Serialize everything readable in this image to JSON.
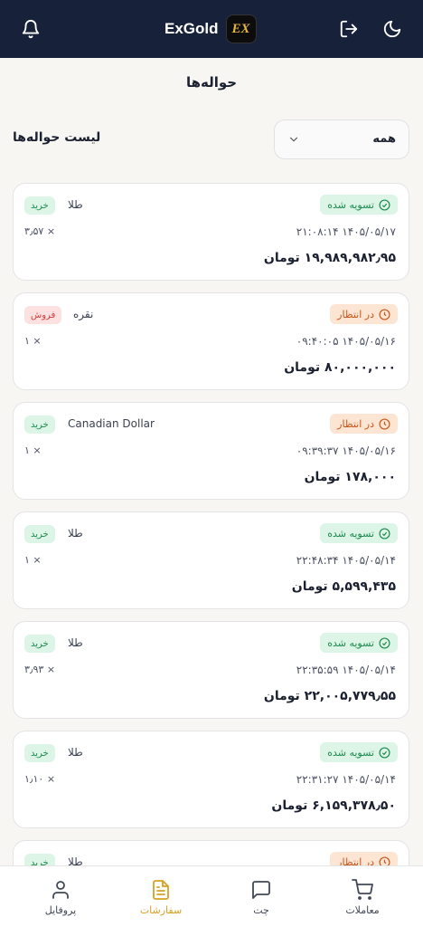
{
  "header": {
    "brand": "ExGold",
    "logo_text": "EX"
  },
  "page": {
    "title": "حواله‌ها",
    "list_title": "لیست حواله‌ها",
    "filter_value": "همه"
  },
  "transfers": [
    {
      "status": "تسویه شده",
      "side": "خرید",
      "asset": "طلا",
      "datetime": "۲۱:۰۸:۱۴ ۱۴۰۵/۰۵/۱۷",
      "qty": "۳٫۵۷ ×",
      "amount": "۱۹,۹۸۹,۹۸۲٫۹۵ تومان"
    },
    {
      "status": "در انتظار",
      "side": "فروش",
      "asset": "نقره",
      "datetime": "۰۹:۴۰:۰۵ ۱۴۰۵/۰۵/۱۶",
      "qty": "۱ ×",
      "amount": "۸۰,۰۰۰,۰۰۰ تومان"
    },
    {
      "status": "در انتظار",
      "side": "خرید",
      "asset": "Canadian Dollar",
      "datetime": "۰۹:۳۹:۳۷ ۱۴۰۵/۰۵/۱۶",
      "qty": "۱ ×",
      "amount": "۱۷۸,۰۰۰ تومان"
    },
    {
      "status": "تسویه شده",
      "side": "خرید",
      "asset": "طلا",
      "datetime": "۲۲:۴۸:۳۴ ۱۴۰۵/۰۵/۱۴",
      "qty": "۱ ×",
      "amount": "۵,۵۹۹,۴۳۵ تومان"
    },
    {
      "status": "تسویه شده",
      "side": "خرید",
      "asset": "طلا",
      "datetime": "۲۲:۳۵:۵۹ ۱۴۰۵/۰۵/۱۴",
      "qty": "۳٫۹۳ ×",
      "amount": "۲۲,۰۰۵,۷۷۹٫۵۵ تومان"
    },
    {
      "status": "تسویه شده",
      "side": "خرید",
      "asset": "طلا",
      "datetime": "۲۲:۳۱:۲۷ ۱۴۰۵/۰۵/۱۴",
      "qty": "۱٫۱۰ ×",
      "amount": "۶,۱۵۹,۳۷۸٫۵۰ تومان"
    },
    {
      "status": "در انتظار",
      "side": "خرید",
      "asset": "طلا",
      "datetime": "",
      "qty": "",
      "amount": ""
    }
  ],
  "nav": {
    "trades": "معاملات",
    "chat": "چت",
    "orders": "سفارشات",
    "profile": "پروفایل"
  },
  "colors": {
    "header_bg": "#17223a",
    "accent": "#d8a021",
    "settled": "#1e8a4f",
    "pending": "#c9561b",
    "sell": "#d23b3b"
  }
}
